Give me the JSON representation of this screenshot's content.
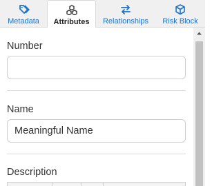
{
  "tabs": [
    {
      "label": "Metadata",
      "icon": "tag-icon",
      "active": false
    },
    {
      "label": "Attributes",
      "icon": "cubes-icon",
      "active": true
    },
    {
      "label": "Relationships",
      "icon": "exchange-arrows-icon",
      "active": false
    },
    {
      "label": "Risk Block",
      "icon": "cube-icon",
      "active": false
    }
  ],
  "fields": {
    "number": {
      "label": "Number",
      "value": ""
    },
    "name": {
      "label": "Name",
      "value": "Meaningful Name"
    },
    "description": {
      "label": "Description"
    }
  },
  "colors": {
    "accent": "#1a73c8",
    "tabbar_bg": "#f0f0f0",
    "border": "#cfcfcf"
  }
}
